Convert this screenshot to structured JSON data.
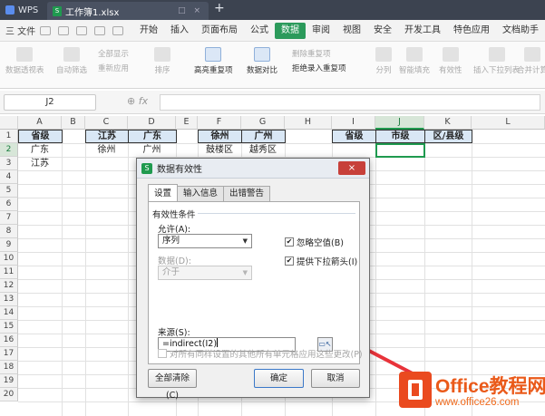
{
  "titlebar": {
    "app_label": "WPS",
    "doc_tab": "工作簿1.xlsx",
    "new_tab": "+"
  },
  "menubar": {
    "file_label": "三 文件",
    "items": [
      "开始",
      "插入",
      "页面布局",
      "公式",
      "数据",
      "审阅",
      "视图",
      "安全",
      "开发工具",
      "特色应用",
      "文档助手"
    ],
    "active": "数据"
  },
  "ribbon": {
    "buttons": [
      "数据透视表",
      "自动筛选",
      "全部显示",
      "重新应用",
      "排序",
      "高亮重复项",
      "数据对比",
      "删除重复项",
      "拒绝录入重复项",
      "分列",
      "智能填充",
      "有效性",
      "插入下拉列表",
      "合并计算"
    ]
  },
  "formula_bar": {
    "name_box": "J2",
    "fx_label": "fx",
    "formula": ""
  },
  "sheet": {
    "columns": [
      "A",
      "B",
      "C",
      "D",
      "E",
      "F",
      "G",
      "H",
      "I",
      "J",
      "K",
      "L"
    ],
    "selected_column": "J",
    "rows": [
      "1",
      "2",
      "3",
      "4",
      "5",
      "6",
      "7",
      "8",
      "9",
      "10",
      "11",
      "12",
      "13",
      "14",
      "15",
      "16",
      "17",
      "18",
      "19",
      "20"
    ],
    "selected_row": "2",
    "cells": {
      "A1": "省级",
      "A2": "广东",
      "A3": "江苏",
      "C1": "江苏",
      "C2": "徐州",
      "D1": "广东",
      "D2": "广州",
      "F1": "徐州",
      "F2": "鼓楼区",
      "G1": "广州",
      "G2": "越秀区",
      "I1": "省级",
      "J1": "市级",
      "K1": "区/县级"
    }
  },
  "dialog": {
    "title": "数据有效性",
    "close_label": "×",
    "tabs": [
      "设置",
      "输入信息",
      "出错警告"
    ],
    "active_tab": "设置",
    "section_label": "有效性条件",
    "allow_label": "允许(A):",
    "allow_value": "序列",
    "data_label": "数据(D):",
    "data_value": "介于",
    "ignore_blank_label": "忽略空值(B)",
    "ignore_blank_checked": true,
    "dropdown_label": "提供下拉箭头(I)",
    "dropdown_checked": true,
    "source_label": "来源(S):",
    "source_value": "=indirect(I2)",
    "apply_all_label": "对所有同样设置的其他所有单元格应用这些更改(P)",
    "apply_all_checked": false,
    "clear_all_label": "全部清除(C)",
    "ok_label": "确定",
    "cancel_label": "取消"
  },
  "annotation": {
    "arrow_color": "#e8333a"
  },
  "watermark": {
    "title": "Office教程网",
    "url": "www.office26.com"
  },
  "colors": {
    "accent": "#2b9a5b",
    "header_fill": "#d9e7f5",
    "selection": "#1f9a4f"
  }
}
